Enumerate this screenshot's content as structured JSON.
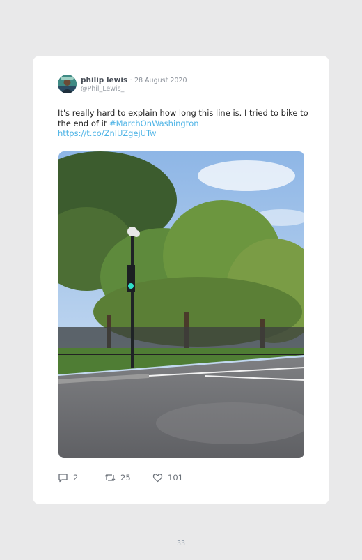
{
  "tweet": {
    "author_name": "philip lewis",
    "separator": "·",
    "date": "28 August 2020",
    "handle": "@Phil_Lewis_",
    "text": "It's really hard to explain how long this line is. I tried to bike to the end of it",
    "hashtag": "#MarchOnWashington",
    "url": "https://t.co/ZnlUZgejUTw",
    "replies": "2",
    "retweets": "25",
    "likes": "101"
  },
  "icons": {
    "reply": "reply-icon",
    "retweet": "retweet-icon",
    "like": "heart-icon"
  },
  "colors": {
    "link": "#4fb4e6",
    "page_background": "#e9e9ea",
    "card_background": "#ffffff"
  },
  "page_number": "33"
}
